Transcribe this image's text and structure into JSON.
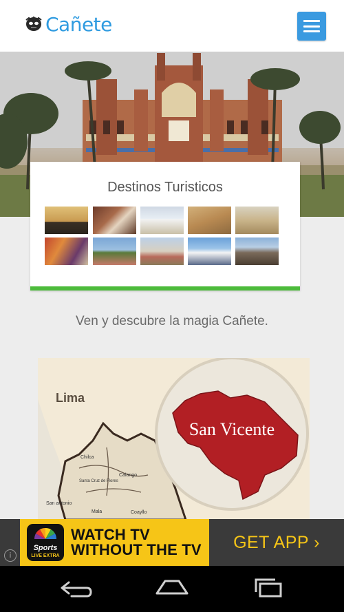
{
  "header": {
    "logo_text": "Cañete",
    "logo_icon": "mask-icon",
    "menu_icon": "hamburger-menu-icon"
  },
  "destinations": {
    "title": "Destinos Turisticos",
    "thumbnails": [
      {
        "name": "pier-sunset-photo"
      },
      {
        "name": "church-altar-photo"
      },
      {
        "name": "chapel-photo"
      },
      {
        "name": "desert-ruins-photo"
      },
      {
        "name": "cathedral-photo"
      },
      {
        "name": "dancers-photo"
      },
      {
        "name": "plaza-photo"
      },
      {
        "name": "town-church-photo"
      },
      {
        "name": "market-photo"
      },
      {
        "name": "rock-formation-photo"
      }
    ]
  },
  "tagline": "Ven y descubre la magia Cañete.",
  "map": {
    "region_label": "Lima",
    "badge_label": "San Vicente",
    "places": [
      "Chilca",
      "Santa Cruz de Flores",
      "Calango",
      "San antonio",
      "Mala",
      "Coayllo"
    ]
  },
  "ad": {
    "info_icon": "i",
    "brand_line1": "Sports",
    "brand_line2": "LIVE EXTRA",
    "headline_line1": "WATCH TV",
    "headline_line2": "WITHOUT THE TV",
    "cta": "GET APP ›",
    "colors": {
      "accent": "#f6c517",
      "dark": "#3a3a3a"
    }
  },
  "colors": {
    "brand_blue": "#2f9be0",
    "menu_blue": "#3a9ae0",
    "card_accent": "#4cbb3b"
  }
}
